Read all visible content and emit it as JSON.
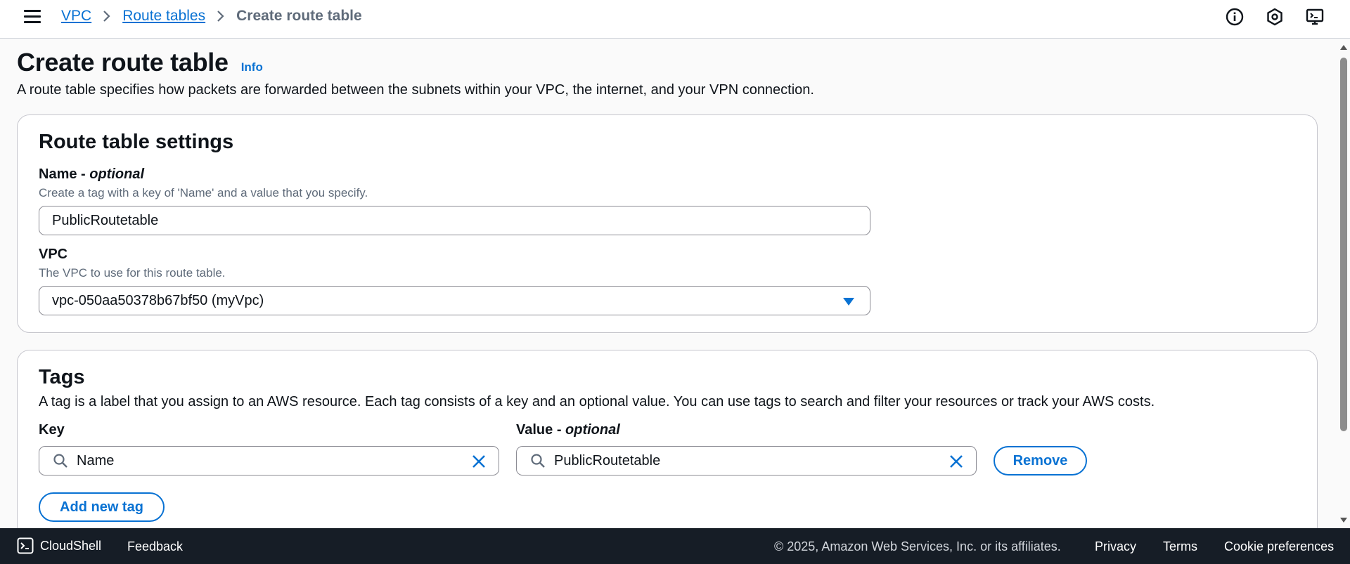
{
  "breadcrumb": {
    "items": [
      "VPC",
      "Route tables"
    ],
    "current": "Create route table"
  },
  "page": {
    "title": "Create route table",
    "info_link": "Info",
    "description": "A route table specifies how packets are forwarded between the subnets within your VPC, the internet, and your VPN connection."
  },
  "settings": {
    "heading": "Route table settings",
    "name_label": "Name - ",
    "name_label_optional": "optional",
    "name_hint": "Create a tag with a key of 'Name' and a value that you specify.",
    "name_value": "PublicRoutetable",
    "vpc_label": "VPC",
    "vpc_hint": "The VPC to use for this route table.",
    "vpc_value": "vpc-050aa50378b67bf50 (myVpc)"
  },
  "tags": {
    "heading": "Tags",
    "description": "A tag is a label that you assign to an AWS resource. Each tag consists of a key and an optional value. You can use tags to search and filter your resources or track your AWS costs.",
    "key_label": "Key",
    "value_label": "Value - ",
    "value_label_optional": "optional",
    "rows": [
      {
        "key": "Name",
        "value": "PublicRoutetable"
      }
    ],
    "remove_label": "Remove",
    "add_label": "Add new tag"
  },
  "footer": {
    "cloudshell": "CloudShell",
    "feedback": "Feedback",
    "copyright": "© 2025, Amazon Web Services, Inc. or its affiliates.",
    "privacy": "Privacy",
    "terms": "Terms",
    "cookies": "Cookie preferences"
  },
  "icons": {
    "menu": "hamburger-icon",
    "info": "info-circle-icon",
    "notifications": "bell-settings-icon",
    "cloudshell": "terminal-icon",
    "search": "search-icon",
    "clear": "close-icon"
  },
  "colors": {
    "accent": "#0972d3",
    "footer_bg": "#161d26",
    "text": "#0f141a",
    "muted": "#5f6b7a"
  }
}
